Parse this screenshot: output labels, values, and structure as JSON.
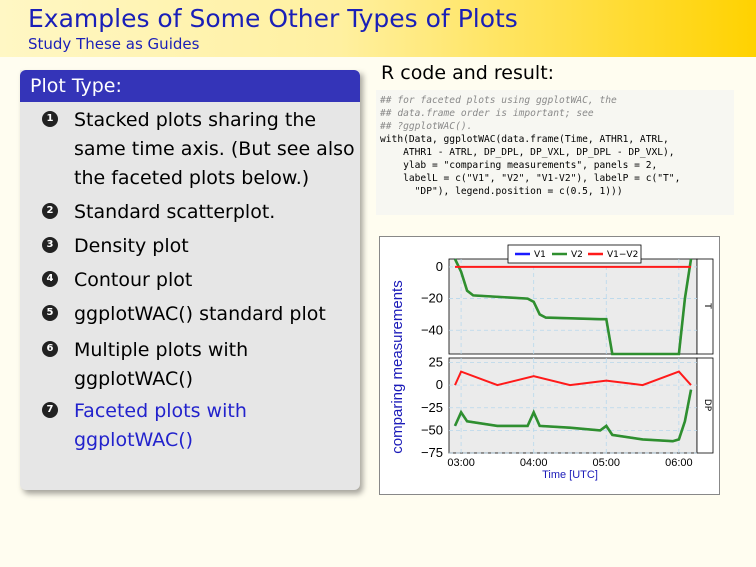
{
  "header": {
    "title": "Examples of Some Other Types of Plots",
    "subtitle": "Study These as Guides"
  },
  "block": {
    "title": "Plot Type:",
    "items": [
      {
        "num": "1",
        "text": "Stacked plots sharing the same time axis. (But see also the faceted plots below.)"
      },
      {
        "num": "2",
        "text": "Standard scatterplot."
      },
      {
        "num": "3",
        "text": "Density plot"
      },
      {
        "num": "4",
        "text": "Contour plot"
      },
      {
        "num": "5",
        "text": "ggplotWAC() standard plot"
      },
      {
        "num": "6",
        "text": "Multiple plots with ggplotWAC()"
      },
      {
        "num": "7",
        "text": "Faceted plots with ggplotWAC()"
      }
    ]
  },
  "rcode": {
    "title": "R code and result:",
    "lines": [
      "## for faceted plots using ggplotWAC, the",
      "## data.frame order is important; see",
      "## ?ggplotWAC().",
      "with(Data, ggplotWAC(data.frame(Time, ATHR1, ATRL,",
      "    ATHR1 - ATRL, DP_DPL, DP_VXL, DP_DPL - DP_VXL),",
      "    ylab = \"comparing measurements\", panels = 2,",
      "    labelL = c(\"V1\", \"V2\", \"V1-V2\"), labelP = c(\"T\",",
      "      \"DP\"), legend.position = c(0.5, 1)))"
    ]
  },
  "plot": {
    "ylabel": "comparing measurements",
    "xlabel": "Time [UTC]",
    "legend": [
      "V1",
      "V2",
      "V1−V2"
    ],
    "colors": {
      "V1": "#1a1aff",
      "V2": "#2f8f2f",
      "V1-V2": "#ff1a1a"
    },
    "panel_labels": [
      "T",
      "DP"
    ],
    "x_ticks": [
      "03:00",
      "04:00",
      "05:00",
      "06:00"
    ],
    "top_y_ticks": [
      "0",
      "−20",
      "−40"
    ],
    "bottom_y_ticks": [
      "25",
      "0",
      "−25",
      "−50",
      "−75"
    ]
  },
  "chart_data": {
    "type": "line",
    "xlabel": "Time [UTC]",
    "ylabel": "comparing measurements",
    "legend_position": "top-center",
    "panels": [
      {
        "label": "T",
        "ylim": [
          -55,
          5
        ],
        "series": [
          {
            "name": "V1",
            "x": [
              "02:55",
              "03:00",
              "03:05",
              "03:10",
              "03:55",
              "04:00",
              "04:05",
              "04:10",
              "04:55",
              "05:00",
              "05:05",
              "05:10",
              "05:55",
              "06:00",
              "06:05",
              "06:10"
            ],
            "y": [
              5,
              -3,
              -15,
              -18,
              -20,
              -22,
              -30,
              -32,
              -33,
              -33,
              -55,
              -55,
              -55,
              -55,
              -20,
              5
            ]
          },
          {
            "name": "V2",
            "x": [
              "02:55",
              "03:00",
              "03:05",
              "03:10",
              "03:55",
              "04:00",
              "04:05",
              "04:10",
              "04:55",
              "05:00",
              "05:05",
              "05:10",
              "05:55",
              "06:00",
              "06:05",
              "06:10"
            ],
            "y": [
              5,
              -3,
              -15,
              -18,
              -20,
              -22,
              -30,
              -32,
              -33,
              -33,
              -55,
              -55,
              -55,
              -55,
              -20,
              5
            ]
          },
          {
            "name": "V1−V2",
            "x": [
              "02:55",
              "06:10"
            ],
            "y": [
              0,
              0
            ]
          }
        ]
      },
      {
        "label": "DP",
        "ylim": [
          -75,
          30
        ],
        "series": [
          {
            "name": "V1",
            "x": [
              "02:55",
              "03:00",
              "03:05",
              "03:30",
              "03:55",
              "04:00",
              "04:05",
              "04:30",
              "04:55",
              "05:00",
              "05:05",
              "05:30",
              "05:55",
              "06:00",
              "06:05",
              "06:10"
            ],
            "y": [
              -45,
              -30,
              -40,
              -45,
              -45,
              -30,
              -45,
              -47,
              -50,
              -45,
              -55,
              -60,
              -62,
              -60,
              -40,
              -5
            ]
          },
          {
            "name": "V2",
            "x": [
              "02:55",
              "03:00",
              "03:05",
              "03:30",
              "03:55",
              "04:00",
              "04:05",
              "04:30",
              "04:55",
              "05:00",
              "05:05",
              "05:30",
              "05:55",
              "06:00",
              "06:05",
              "06:10"
            ],
            "y": [
              -45,
              -30,
              -40,
              -45,
              -45,
              -30,
              -45,
              -47,
              -50,
              -45,
              -55,
              -60,
              -62,
              -60,
              -40,
              -5
            ]
          },
          {
            "name": "V1−V2",
            "x": [
              "02:55",
              "03:00",
              "03:30",
              "04:00",
              "04:30",
              "05:00",
              "05:30",
              "06:00",
              "06:10"
            ],
            "y": [
              0,
              15,
              0,
              10,
              0,
              5,
              0,
              15,
              0
            ]
          }
        ]
      }
    ]
  }
}
